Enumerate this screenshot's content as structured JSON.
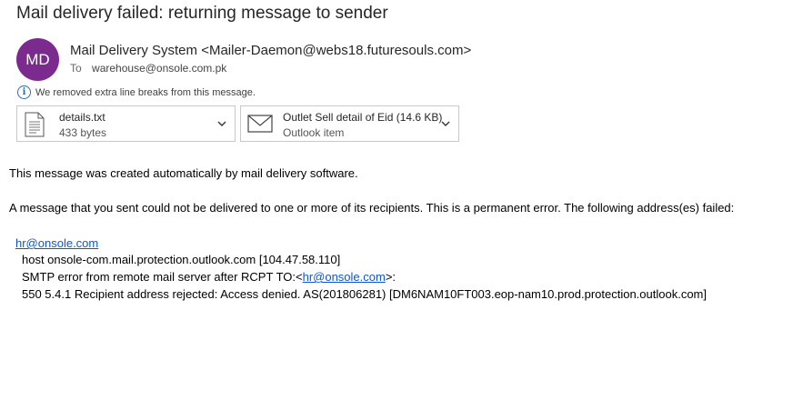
{
  "message": {
    "subject": "Mail delivery failed: returning message to sender",
    "avatar_initials": "MD",
    "avatar_color": "#7b2b8e",
    "sender": "Mail Delivery System <Mailer-Daemon@webs18.futuresouls.com>",
    "to_label": "To",
    "to_address": "warehouse@onsole.com.pk",
    "info_notice": "We removed extra line breaks from this message."
  },
  "attachments": [
    {
      "name": "details.txt",
      "meta": "433 bytes",
      "icon": "text-file-icon"
    },
    {
      "name": "Outlet Sell detail of Eid (14.6 KB)",
      "meta": "Outlook item",
      "icon": "envelope-icon"
    }
  ],
  "body": {
    "line1": "This message was created automatically by mail delivery software.",
    "line2": "A message that you sent could not be delivered to one or more of its recipients. This is a permanent error. The following address(es) failed:",
    "failed_address": "hr@onsole.com",
    "host_line": "host onsole-com.mail.protection.outlook.com [104.47.58.110]",
    "smtp_prefix": "SMTP error from remote mail server after RCPT TO:<",
    "smtp_address": "hr@onsole.com",
    "smtp_suffix": ">:",
    "error_line": "550 5.4.1 Recipient address rejected: Access denied. AS(201806281) [DM6NAM10FT003.eop-nam10.prod.protection.outlook.com]"
  },
  "colors": {
    "link": "#1155cc",
    "info_icon": "#2b6cb0"
  }
}
